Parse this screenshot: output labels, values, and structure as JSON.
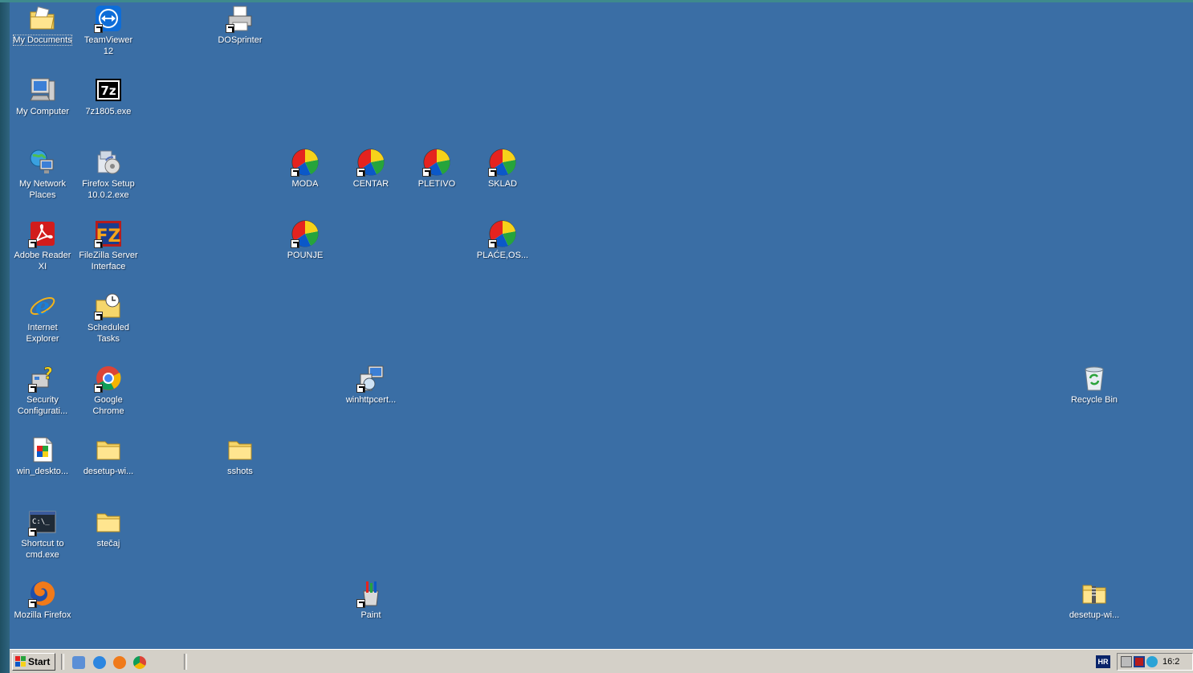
{
  "desktop": {
    "icons": [
      {
        "label": "My Documents",
        "icon": "my-documents-icon"
      },
      {
        "label": "TeamViewer\n12",
        "icon": "teamviewer-icon"
      },
      {
        "label": "DOSprinter",
        "icon": "printer-icon"
      },
      {
        "label": "My Computer",
        "icon": "my-computer-icon"
      },
      {
        "label": "7z1805.exe",
        "icon": "7zip-icon"
      },
      {
        "label": "My Network\nPlaces",
        "icon": "network-places-icon"
      },
      {
        "label": "Firefox Setup\n10.0.2.exe",
        "icon": "installer-icon"
      },
      {
        "label": "MODA",
        "icon": "beach-ball-icon"
      },
      {
        "label": "CENTAR",
        "icon": "beach-ball-icon"
      },
      {
        "label": "PLETIVO",
        "icon": "beach-ball-icon"
      },
      {
        "label": "SKLAD",
        "icon": "beach-ball-icon"
      },
      {
        "label": "Adobe Reader\nXI",
        "icon": "adobe-reader-icon"
      },
      {
        "label": "FileZilla Server\nInterface",
        "icon": "filezilla-icon"
      },
      {
        "label": "POUNJE",
        "icon": "beach-ball-icon"
      },
      {
        "label": "PLAĆE,OS...",
        "icon": "beach-ball-icon"
      },
      {
        "label": "Internet\nExplorer",
        "icon": "internet-explorer-icon"
      },
      {
        "label": "Scheduled\nTasks",
        "icon": "scheduled-tasks-icon"
      },
      {
        "label": "Security\nConfigurati...",
        "icon": "security-config-icon"
      },
      {
        "label": "Google\nChrome",
        "icon": "chrome-icon"
      },
      {
        "label": "winhttpcert...",
        "icon": "cert-tool-icon"
      },
      {
        "label": "Recycle Bin",
        "icon": "recycle-bin-icon"
      },
      {
        "label": "win_deskto...",
        "icon": "document-icon"
      },
      {
        "label": "desetup-wi...",
        "icon": "folder-icon"
      },
      {
        "label": "sshots",
        "icon": "folder-icon"
      },
      {
        "label": "Shortcut to\ncmd.exe",
        "icon": "cmd-icon"
      },
      {
        "label": "stečaj",
        "icon": "folder-icon"
      },
      {
        "label": "Mozilla Firefox",
        "icon": "firefox-icon"
      },
      {
        "label": "Paint",
        "icon": "paint-icon"
      },
      {
        "label": "desetup-wi...",
        "icon": "zip-folder-icon"
      }
    ]
  },
  "taskbar": {
    "start_label": "Start",
    "language": "HR",
    "clock": "16:2"
  },
  "colors": {
    "desktop": "#3a6ea5",
    "taskbar": "#d4d0c8"
  }
}
